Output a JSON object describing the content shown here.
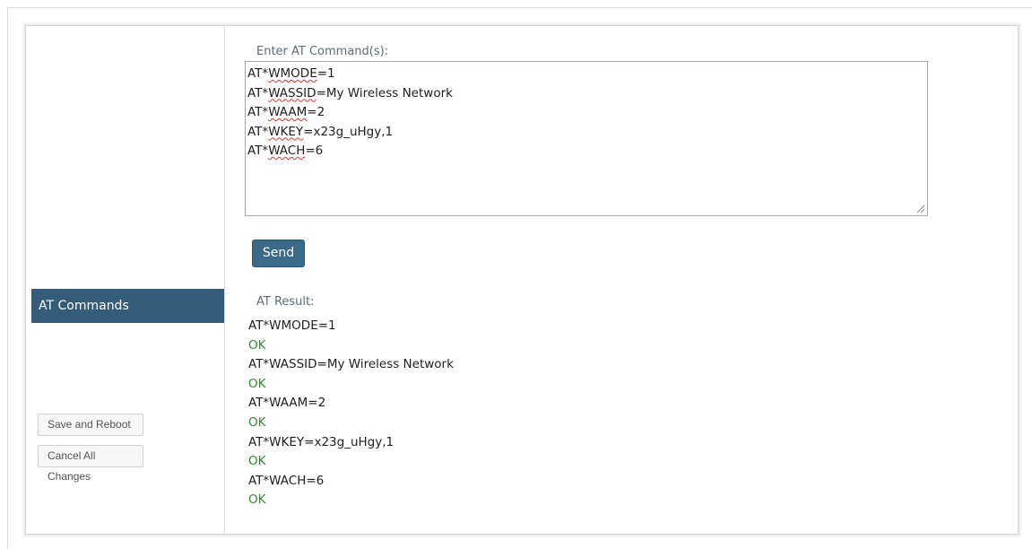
{
  "sidebar": {
    "active_item": "AT Commands",
    "save_reboot_label": "Save and Reboot",
    "cancel_changes_label": "Cancel All Changes"
  },
  "command_section": {
    "label": "Enter AT Command(s):",
    "lines": [
      {
        "prefix": "AT*",
        "keyword": "WMODE",
        "suffix": "=1"
      },
      {
        "prefix": "AT*",
        "keyword": "WASSID",
        "suffix": "=My Wireless Network"
      },
      {
        "prefix": "AT*",
        "keyword": "WAAM",
        "suffix": "=2"
      },
      {
        "prefix": "AT*",
        "keyword": "WKEY",
        "suffix": "=x23g_uHgy,1"
      },
      {
        "prefix": "AT*",
        "keyword": "WACH",
        "suffix": "=6"
      }
    ],
    "send_label": "Send"
  },
  "result_section": {
    "label": "AT Result:",
    "lines": [
      {
        "text": "AT*WMODE=1",
        "ok": false
      },
      {
        "text": "OK",
        "ok": true
      },
      {
        "text": "AT*WASSID=My Wireless Network",
        "ok": false
      },
      {
        "text": "OK",
        "ok": true
      },
      {
        "text": "AT*WAAM=2",
        "ok": false
      },
      {
        "text": "OK",
        "ok": true
      },
      {
        "text": "AT*WKEY=x23g_uHgy,1",
        "ok": false
      },
      {
        "text": "OK",
        "ok": true
      },
      {
        "text": "AT*WACH=6",
        "ok": false
      },
      {
        "text": "OK",
        "ok": true
      }
    ]
  },
  "colors": {
    "nav_active_bg": "#345d7a",
    "send_button_bg": "#3a6989",
    "ok_text": "#2e8b2e",
    "label_text": "#5c6b77"
  }
}
